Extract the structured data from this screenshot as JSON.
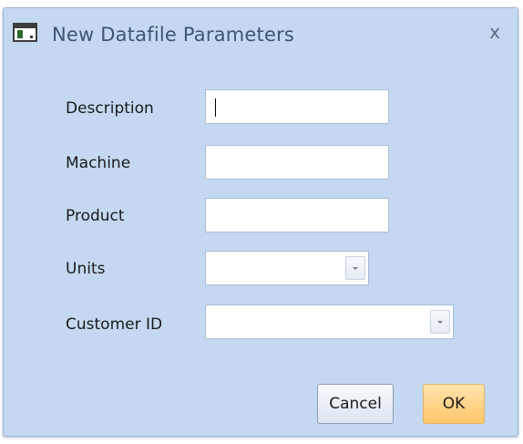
{
  "window": {
    "title": "New Datafile Parameters",
    "close_glyph": "x"
  },
  "form": {
    "description_label": "Description",
    "description_value": "",
    "machine_label": "Machine",
    "machine_value": "",
    "product_label": "Product",
    "product_value": "",
    "units_label": "Units",
    "units_value": "",
    "customer_id_label": "Customer ID",
    "customer_id_value": ""
  },
  "buttons": {
    "cancel_label": "Cancel",
    "ok_label": "OK"
  },
  "colors": {
    "dialog_background": "#c4d9f1",
    "title_text": "#3f5476",
    "ok_button": "#ffc66a"
  },
  "icons": {
    "app_icon": "window-app-icon",
    "close_icon": "close-x-icon",
    "dropdown_icon": "chevron-down-icon"
  }
}
